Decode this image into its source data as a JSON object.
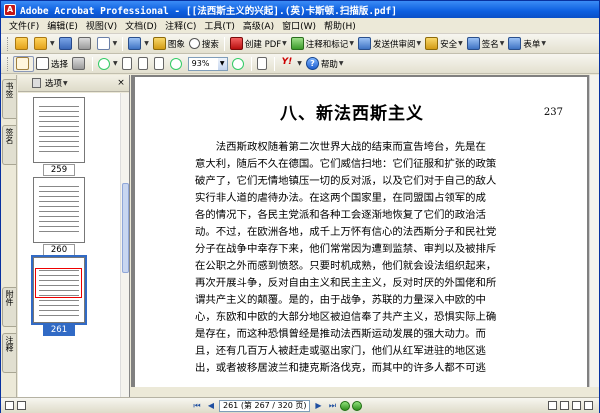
{
  "window": {
    "title": "Adobe Acrobat Professional - [[法西斯主义的兴起].(英)卡斯顿.扫描版.pdf]",
    "app_icon_letter": "A"
  },
  "menu": [
    "文件(F)",
    "编辑(E)",
    "视图(V)",
    "文档(D)",
    "注释(C)",
    "工具(T)",
    "高级(A)",
    "窗口(W)",
    "帮助(H)"
  ],
  "toolbar1": {
    "image_label": "图象",
    "search_label": "搜索",
    "create_pdf_label": "创建 PDF",
    "comment_label": "注释和标记",
    "send_review_label": "发送供审阅",
    "security_label": "安全",
    "sign_label": "签名",
    "forms_label": "表单"
  },
  "toolbar2": {
    "select_label": "选择",
    "zoom_value": "93%",
    "help_label": "帮助",
    "yahoo_label": "Y!"
  },
  "side_tabs": [
    "书签",
    "签名",
    "附件",
    "注释"
  ],
  "thumb_panel": {
    "options_label": "选项",
    "close_symbol": "×",
    "thumbnails": [
      {
        "number": "259",
        "selected": false
      },
      {
        "number": "260",
        "selected": false
      },
      {
        "number": "261",
        "selected": true
      }
    ]
  },
  "document": {
    "heading": "八、新法西斯主义",
    "page_number": "237",
    "lines": [
      "　　法西斯政权随着第二次世界大战的结束而宣告垮台，先是在",
      "意大利，随后不久在德国。它们威信扫地：它们征服和扩张的政策",
      "破产了，它们无情地镇压一切的反对派，以及它们对于自己的敌人",
      "实行非人道的虐待办法。在这两个国家里，在同盟国占领军的成",
      "各的情况下，各民主党派和各种工会逐渐地恢复了它们的政治活",
      "动。不过，在欧洲各地，成千上万怀有信心的法西斯分子和民社党",
      "分子在战争中幸存下来，他们常常因为遭到监禁、审判以及被排斥",
      "在公职之外而感到愤怒。只要时机成熟，他们就会设法组织起来，",
      "再次开展斗争，反对自由主义和民主主义，反对时厌的外国佬和所",
      "谓共产主义的颠覆。是的，由于战争，苏联的力量深入中欧的中",
      "心，东欧和中欧的大部分地区被迫信奉了共产主义，恐惧实际上确",
      "是存在，而这种恐惧曾经是推动法西斯运动发展的强大动力。而",
      "且，还有几百万人被赶走或驱出家门，他们从红军进驻的地区逃",
      "出，或者被移居波兰和捷克斯洛伐克，而其中的许多人都不可逃"
    ]
  },
  "navigation": {
    "first": "⏮",
    "prev": "◀",
    "page_field": "261 (第 267 / 320 页)",
    "next": "▶",
    "last": "⏭"
  }
}
